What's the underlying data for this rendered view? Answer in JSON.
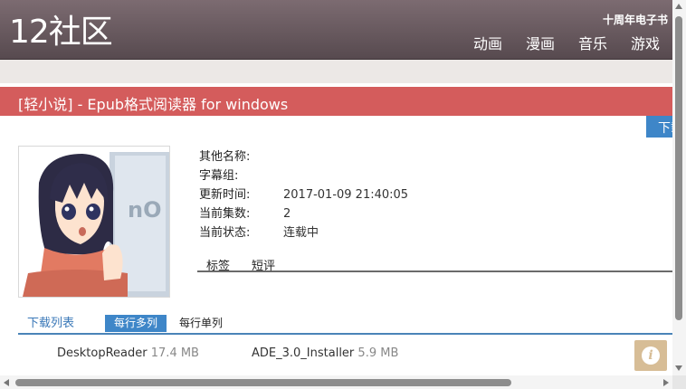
{
  "header": {
    "logo": "12社区",
    "top_link": "十周年电子书",
    "nav": [
      "动画",
      "漫画",
      "音乐",
      "游戏"
    ]
  },
  "title": "[轻小说] - Epub格式阅读器 for windows",
  "download_tab": "下载",
  "meta": [
    {
      "key": "其他名称:",
      "value": ""
    },
    {
      "key": "字幕组:",
      "value": ""
    },
    {
      "key": "更新时间:",
      "value": "2017-01-09 21:40:05"
    },
    {
      "key": "当前集数:",
      "value": "2"
    },
    {
      "key": "当前状态:",
      "value": "连载中"
    }
  ],
  "sub_tabs": [
    "标签",
    "短评"
  ],
  "list": {
    "label": "下载列表",
    "multi": "每行多列",
    "single": "每行单列"
  },
  "files": [
    {
      "name": "DesktopReader",
      "size": "17.4 MB"
    },
    {
      "name": "ADE_3.0_Installer",
      "size": "5.9 MB"
    }
  ],
  "info_icon": "i",
  "colors": {
    "header": "#6b5b61",
    "title_bar": "#d45c5c",
    "accent_blue": "#3e86c8",
    "info_button": "#d7bd96"
  }
}
